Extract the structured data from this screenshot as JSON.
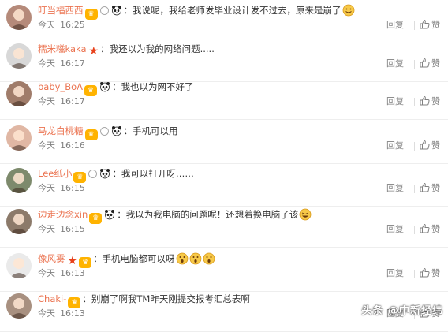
{
  "actions": {
    "reply_label": "回复",
    "like_label": "赞"
  },
  "comments": [
    {
      "user": "叮当福西西",
      "text": "我说呢，我给老师发毕业设计发不过去，原来是崩了",
      "day": "今天",
      "time": "16:25",
      "avatar_color": "#b58a7a"
    },
    {
      "user": "糯米糍kaka",
      "text": "我还以为我的网络问题.....",
      "day": "今天",
      "time": "16:17",
      "avatar_color": "#d8d8d8"
    },
    {
      "user": "baby_BoA",
      "text": "我也以为网不好了",
      "day": "今天",
      "time": "16:17",
      "avatar_color": "#a07c6a"
    },
    {
      "user": "马龙白桃糖",
      "text": "手机可以用",
      "day": "今天",
      "time": "16:16",
      "avatar_color": "#e0b7a4"
    },
    {
      "user": "Lee纸小",
      "text": "我可以打开呀……",
      "day": "今天",
      "time": "16:15",
      "avatar_color": "#7d8a6c"
    },
    {
      "user": "边走边念xin",
      "text": "我以为我电脑的问题呢！还想着换电脑了该",
      "day": "今天",
      "time": "16:15",
      "avatar_color": "#8c7a6a"
    },
    {
      "user": "像风雾",
      "text": "手机电脑都可以呀",
      "day": "今天",
      "time": "16:13",
      "avatar_color": "#eaeaea"
    },
    {
      "user": "Chaki-",
      "text": "别崩了啊我TM昨天刚提交报考汇总表啊",
      "day": "今天",
      "time": "16:13",
      "avatar_color": "#a89080"
    }
  ],
  "watermark": "头条 @中新经纬"
}
